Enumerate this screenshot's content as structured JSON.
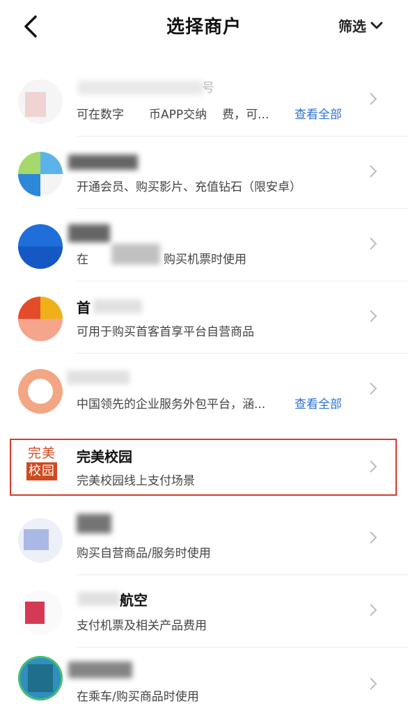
{
  "header": {
    "title": "选择商户",
    "filter_label": "筛选"
  },
  "merchants": [
    {
      "name": "号",
      "desc_a": "可在数字",
      "desc_b": "币APP交纳",
      "desc_c": "费，可...",
      "view_all": "查看全部"
    },
    {
      "name": "",
      "desc": "开通会员、购买影片、充值钻石（限安卓）"
    },
    {
      "name": "",
      "desc_a": "在",
      "desc_b": "购买机票时使用"
    },
    {
      "name": "首",
      "desc": "可用于购买首客首享平台自营商品"
    },
    {
      "name": "",
      "desc": "中国领先的企业服务外包平台，涵...",
      "view_all": "查看全部"
    },
    {
      "name": "完美校园",
      "desc": "完美校园线上支付场景",
      "logo_top": "完美",
      "logo_bottom": "校园"
    },
    {
      "name": "",
      "desc": "购买自营商品/服务时使用"
    },
    {
      "name": "航空",
      "desc": "支付机票及相关产品费用"
    },
    {
      "name": "",
      "desc": "在乘车/购买商品时使用"
    }
  ]
}
